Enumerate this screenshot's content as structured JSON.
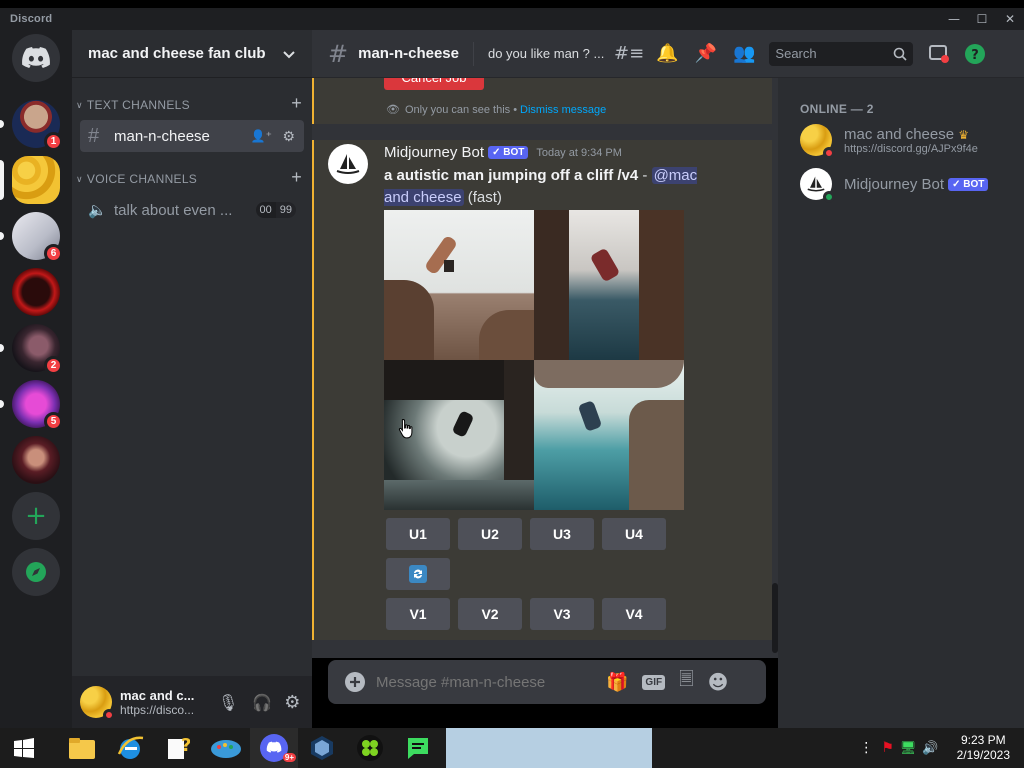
{
  "window": {
    "app_name": "Discord"
  },
  "servers": [
    {
      "name": "server-politician",
      "badge": "1"
    },
    {
      "name": "mac-and-cheese",
      "badge": ""
    },
    {
      "name": "server-white",
      "badge": "6"
    },
    {
      "name": "server-red-logo",
      "badge": ""
    },
    {
      "name": "server-dark",
      "badge": "2"
    },
    {
      "name": "server-neon",
      "badge": "5"
    },
    {
      "name": "server-portrait",
      "badge": ""
    }
  ],
  "guild": {
    "name": "mac and cheese fan club"
  },
  "categories": {
    "text": "TEXT CHANNELS",
    "voice": "VOICE CHANNELS"
  },
  "channels": {
    "text": {
      "name": "man-n-cheese"
    },
    "voice": {
      "name": "talk about even ...",
      "count_a": "00",
      "count_b": "99"
    }
  },
  "user_panel": {
    "name": "mac and c...",
    "status": "https://disco..."
  },
  "header": {
    "channel": "man-n-cheese",
    "topic": "do you like man ? ...",
    "search_placeholder": "Search"
  },
  "messages": {
    "ephemeral": {
      "button": "Cancel Job",
      "note": "Only you can see this •",
      "dismiss": "Dismiss message"
    },
    "bot": {
      "author": "Midjourney Bot",
      "badge": "✓ BOT",
      "timestamp": "Today at 9:34 PM",
      "prompt": "a autistic man jumping off a cliff /v4",
      "sep": " - ",
      "mention": "@mac and cheese",
      "suffix": "(fast)"
    },
    "upscale_buttons": [
      "U1",
      "U2",
      "U3",
      "U4"
    ],
    "variation_buttons": [
      "V1",
      "V2",
      "V3",
      "V4"
    ]
  },
  "composer": {
    "placeholder": "Message #man-n-cheese",
    "gif": "GIF"
  },
  "members": {
    "header": "ONLINE — 2",
    "list": [
      {
        "name": "mac and cheese",
        "status": "https://discord.gg/AJPx9f4e"
      },
      {
        "name": "Midjourney Bot",
        "badge": "✓ BOT"
      }
    ]
  },
  "taskbar": {
    "time": "9:23 PM",
    "date": "2/19/2023",
    "discord_badge": "9+"
  },
  "colors": {
    "accent": "#5865f2",
    "online": "#23a559",
    "dnd": "#f23f43",
    "mention_bg": "#3c4270",
    "highlight_border": "#f0b232"
  }
}
